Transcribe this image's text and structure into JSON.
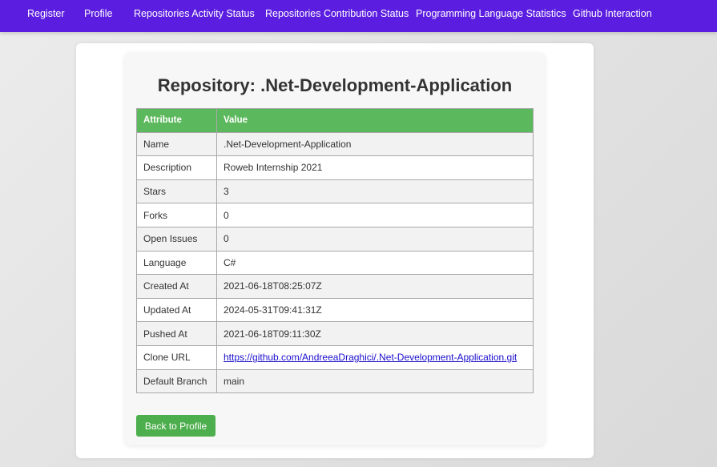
{
  "nav": {
    "items": [
      {
        "label": "Register"
      },
      {
        "label": "Profile"
      },
      {
        "label": "Repositories Activity Status"
      },
      {
        "label": "Repositories Contribution Status"
      },
      {
        "label": "Programming Language Statistics"
      },
      {
        "label": "Github Interaction"
      }
    ]
  },
  "page": {
    "title": "Repository: .Net-Development-Application"
  },
  "table": {
    "headers": [
      "Attribute",
      "Value"
    ],
    "rows": [
      {
        "attribute": "Name",
        "value": ".Net-Development-Application"
      },
      {
        "attribute": "Description",
        "value": "Roweb Internship 2021"
      },
      {
        "attribute": "Stars",
        "value": "3"
      },
      {
        "attribute": "Forks",
        "value": "0"
      },
      {
        "attribute": "Open Issues",
        "value": "0"
      },
      {
        "attribute": "Language",
        "value": "C#"
      },
      {
        "attribute": "Created At",
        "value": "2021-06-18T08:25:07Z"
      },
      {
        "attribute": "Updated At",
        "value": "2024-05-31T09:41:31Z"
      },
      {
        "attribute": "Pushed At",
        "value": "2021-06-18T09:11:30Z"
      },
      {
        "attribute": "Clone URL",
        "value": "https://github.com/AndreeaDraghici/.Net-Development-Application.git"
      },
      {
        "attribute": "Default Branch",
        "value": "main"
      }
    ]
  },
  "actions": {
    "back_label": "Back to Profile"
  },
  "colors": {
    "navbar": "#5b1ee0",
    "table_header": "#5cb85c",
    "button": "#4cae4c",
    "link": "#1a0dcc"
  }
}
